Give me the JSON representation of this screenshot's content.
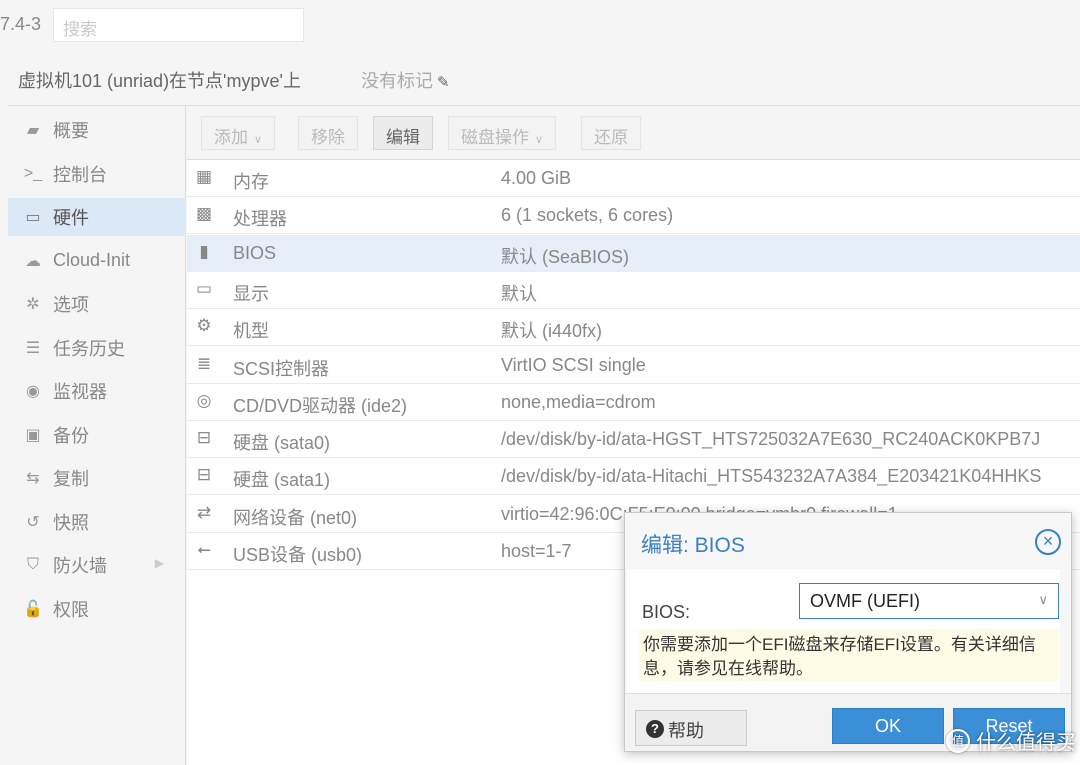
{
  "topbar": {
    "version": "7.4-3",
    "search_placeholder": "搜索"
  },
  "header": {
    "title": "虚拟机101 (unriad)在节点'mypve'上",
    "tags": "没有标记"
  },
  "sidebar": {
    "items": [
      {
        "label": "概要",
        "icon": "book-icon",
        "glyph": "▰"
      },
      {
        "label": "控制台",
        "icon": "terminal-icon",
        "glyph": ">_"
      },
      {
        "label": "硬件",
        "icon": "monitor-icon",
        "glyph": "▭"
      },
      {
        "label": "Cloud-Init",
        "icon": "cloud-icon",
        "glyph": "☁"
      },
      {
        "label": "选项",
        "icon": "gear-icon",
        "glyph": "✲"
      },
      {
        "label": "任务历史",
        "icon": "list-icon",
        "glyph": "☰"
      },
      {
        "label": "监视器",
        "icon": "eye-icon",
        "glyph": "◉"
      },
      {
        "label": "备份",
        "icon": "floppy-icon",
        "glyph": "▣"
      },
      {
        "label": "复制",
        "icon": "retweet-icon",
        "glyph": "⇆"
      },
      {
        "label": "快照",
        "icon": "history-icon",
        "glyph": "↺"
      },
      {
        "label": "防火墙",
        "icon": "shield-icon",
        "glyph": "⛉"
      },
      {
        "label": "权限",
        "icon": "unlock-icon",
        "glyph": "🔓"
      }
    ],
    "active_index": 2
  },
  "toolbar": {
    "add": "添加",
    "remove": "移除",
    "edit": "编辑",
    "disk_action": "磁盘操作",
    "revert": "还原"
  },
  "hardware": [
    {
      "icon": "memory-icon",
      "glyph": "▦",
      "name": "内存",
      "value": "4.00 GiB"
    },
    {
      "icon": "cpu-icon",
      "glyph": "▩",
      "name": "处理器",
      "value": "6 (1 sockets, 6 cores)"
    },
    {
      "icon": "microchip-icon",
      "glyph": "▮",
      "name": "BIOS",
      "value": "默认 (SeaBIOS)"
    },
    {
      "icon": "desktop-icon",
      "glyph": "▭",
      "name": "显示",
      "value": "默认"
    },
    {
      "icon": "cogs-icon",
      "glyph": "⚙",
      "name": "机型",
      "value": "默认 (i440fx)"
    },
    {
      "icon": "database-icon",
      "glyph": "≣",
      "name": "SCSI控制器",
      "value": "VirtIO SCSI single"
    },
    {
      "icon": "cdrom-icon",
      "glyph": "◎",
      "name": "CD/DVD驱动器 (ide2)",
      "value": "none,media=cdrom"
    },
    {
      "icon": "hdd-icon",
      "glyph": "⊟",
      "name": "硬盘 (sata0)",
      "value": "/dev/disk/by-id/ata-HGST_HTS725032A7E630_RC240ACK0KPB7J"
    },
    {
      "icon": "hdd-icon",
      "glyph": "⊟",
      "name": "硬盘 (sata1)",
      "value": "/dev/disk/by-id/ata-Hitachi_HTS543232A7A384_E203421K04HHKS"
    },
    {
      "icon": "exchange-icon",
      "glyph": "⇄",
      "name": "网络设备 (net0)",
      "value": "virtio=42:96:0C:F5:E0:00,bridge=vmbr0,firewall=1"
    },
    {
      "icon": "usb-icon",
      "glyph": "⭠",
      "name": "USB设备 (usb0)",
      "value": "host=1-7"
    }
  ],
  "selected_row": 2,
  "dialog": {
    "title": "编辑: BIOS",
    "field_label": "BIOS:",
    "field_value": "OVMF (UEFI)",
    "hint": "你需要添加一个EFI磁盘来存储EFI设置。有关详细信息，请参见在线帮助。",
    "help": "帮助",
    "ok": "OK",
    "reset": "Reset"
  },
  "watermark": "什么值得买"
}
